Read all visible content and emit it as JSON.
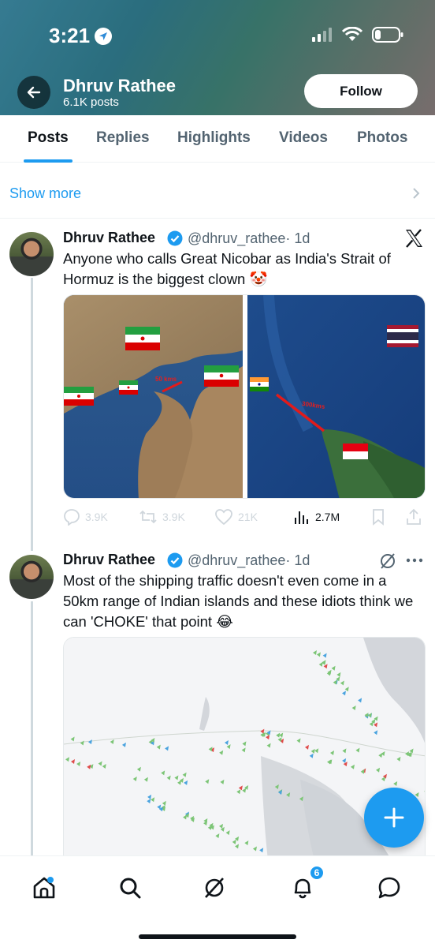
{
  "status_bar": {
    "time": "3:21"
  },
  "profile": {
    "name": "Dhruv Rathee",
    "posts_count": "6.1K posts",
    "follow_label": "Follow"
  },
  "tabs": [
    {
      "label": "Posts",
      "active": true
    },
    {
      "label": "Replies"
    },
    {
      "label": "Highlights"
    },
    {
      "label": "Videos"
    },
    {
      "label": "Photos"
    }
  ],
  "show_more": "Show more",
  "tweets": [
    {
      "name": "Dhruv Rathee",
      "handle": "@dhruv_rathee",
      "time": "· 1d",
      "text": "Anyone who calls Great Nicobar as India's Strait of Hormuz is the biggest clown 🤡",
      "media_left_label": "50 kms",
      "media_right_label": "300kms",
      "stats": {
        "replies": "3.9K",
        "reposts": "3.9K",
        "likes": "21K",
        "views": "2.7M"
      }
    },
    {
      "name": "Dhruv Rathee",
      "handle": "@dhruv_rathee",
      "time": "· 1d",
      "text": "Most of the shipping traffic doesn't even come in a 50km range of Indian islands and these idiots think we can 'CHOKE' that point 😂"
    }
  ],
  "notifications_badge": "6",
  "colors": {
    "accent": "#1d9bf0",
    "text": "#0f1419",
    "secondary": "#536471"
  }
}
